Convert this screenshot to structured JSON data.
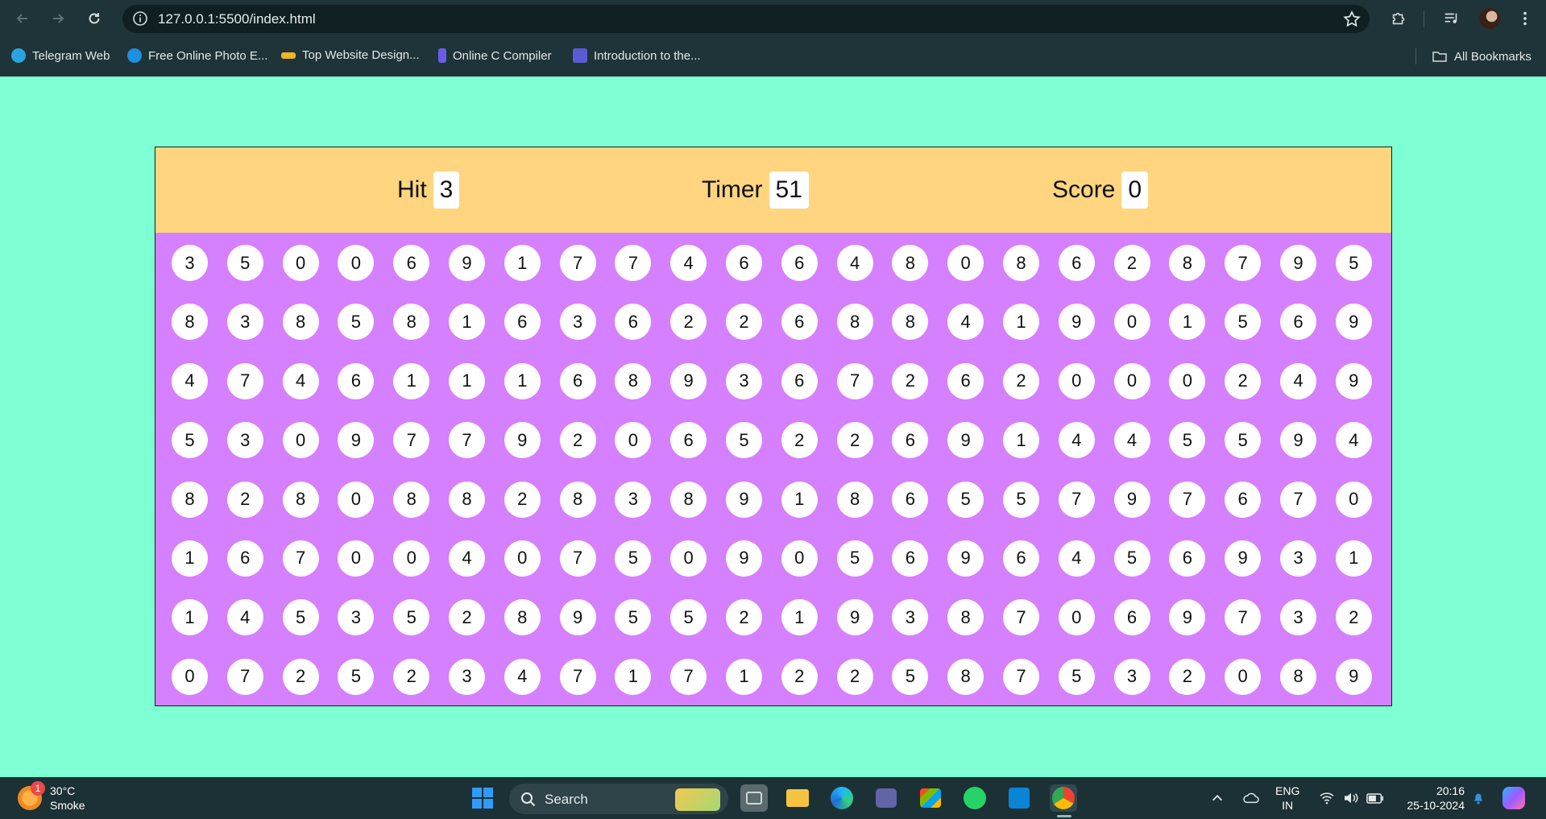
{
  "browser": {
    "url": "127.0.0.1:5500/index.html",
    "bookmarks": [
      {
        "label": "Telegram Web",
        "icon": "telegram-icon",
        "color": "#2aa3e0"
      },
      {
        "label": "Free Online Photo E...",
        "icon": "canva-icon",
        "color": "#1f8fe0"
      },
      {
        "label": "Top Website Design...",
        "icon": "design-icon",
        "color": "#f0b429"
      },
      {
        "label": "Online C Compiler",
        "icon": "compiler-icon",
        "color": "#6c5ce7"
      },
      {
        "label": "Introduction to the...",
        "icon": "terminal-icon",
        "color": "#5b5bd6"
      }
    ],
    "all_bookmarks": "All Bookmarks"
  },
  "game": {
    "hit_label": "Hit",
    "hit_value": "3",
    "timer_label": "Timer",
    "timer_value": "51",
    "score_label": "Score",
    "score_value": "0",
    "colors": {
      "background": "#7fffd4",
      "panel": "#d580ff",
      "topbar": "#ffd580"
    },
    "bubbles": [
      [
        "3",
        "5",
        "0",
        "0",
        "6",
        "9",
        "1",
        "7",
        "7",
        "4",
        "6",
        "6",
        "4",
        "8",
        "0",
        "8",
        "6",
        "2",
        "8",
        "7",
        "9",
        "5"
      ],
      [
        "8",
        "3",
        "8",
        "5",
        "8",
        "1",
        "6",
        "3",
        "6",
        "2",
        "2",
        "6",
        "8",
        "8",
        "4",
        "1",
        "9",
        "0",
        "1",
        "5",
        "6",
        "9"
      ],
      [
        "4",
        "7",
        "4",
        "6",
        "1",
        "1",
        "1",
        "6",
        "8",
        "9",
        "3",
        "6",
        "7",
        "2",
        "6",
        "2",
        "0",
        "0",
        "0",
        "2",
        "4",
        "9"
      ],
      [
        "5",
        "3",
        "0",
        "9",
        "7",
        "7",
        "9",
        "2",
        "0",
        "6",
        "5",
        "2",
        "2",
        "6",
        "9",
        "1",
        "4",
        "4",
        "5",
        "5",
        "9",
        "4"
      ],
      [
        "8",
        "2",
        "8",
        "0",
        "8",
        "8",
        "2",
        "8",
        "3",
        "8",
        "9",
        "1",
        "8",
        "6",
        "5",
        "5",
        "7",
        "9",
        "7",
        "6",
        "7",
        "0"
      ],
      [
        "1",
        "6",
        "7",
        "0",
        "0",
        "4",
        "0",
        "7",
        "5",
        "0",
        "9",
        "0",
        "5",
        "6",
        "9",
        "6",
        "4",
        "5",
        "6",
        "9",
        "3",
        "1"
      ],
      [
        "1",
        "4",
        "5",
        "3",
        "5",
        "2",
        "8",
        "9",
        "5",
        "5",
        "2",
        "1",
        "9",
        "3",
        "8",
        "7",
        "0",
        "6",
        "9",
        "7",
        "3",
        "2"
      ],
      [
        "0",
        "7",
        "2",
        "5",
        "2",
        "3",
        "4",
        "7",
        "1",
        "7",
        "1",
        "2",
        "2",
        "5",
        "8",
        "7",
        "5",
        "3",
        "2",
        "0",
        "8",
        "9"
      ]
    ]
  },
  "taskbar": {
    "weather_temp": "30°C",
    "weather_desc": "Smoke",
    "weather_badge": "1",
    "search_label": "Search",
    "lang_top": "ENG",
    "lang_bottom": "IN",
    "time": "20:16",
    "date": "25-10-2024"
  }
}
